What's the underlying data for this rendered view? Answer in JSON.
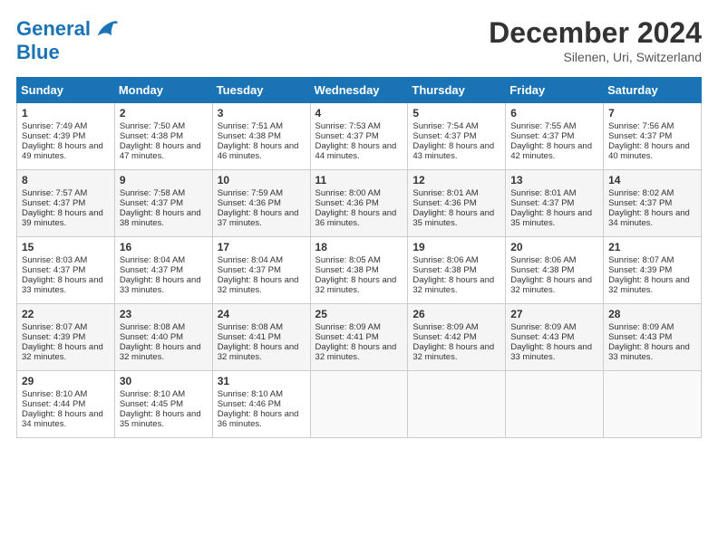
{
  "header": {
    "logo_line1": "General",
    "logo_line2": "Blue",
    "month": "December 2024",
    "location": "Silenen, Uri, Switzerland"
  },
  "days_of_week": [
    "Sunday",
    "Monday",
    "Tuesday",
    "Wednesday",
    "Thursday",
    "Friday",
    "Saturday"
  ],
  "weeks": [
    [
      {
        "day": "1",
        "sunrise": "Sunrise: 7:49 AM",
        "sunset": "Sunset: 4:39 PM",
        "daylight": "Daylight: 8 hours and 49 minutes."
      },
      {
        "day": "2",
        "sunrise": "Sunrise: 7:50 AM",
        "sunset": "Sunset: 4:38 PM",
        "daylight": "Daylight: 8 hours and 47 minutes."
      },
      {
        "day": "3",
        "sunrise": "Sunrise: 7:51 AM",
        "sunset": "Sunset: 4:38 PM",
        "daylight": "Daylight: 8 hours and 46 minutes."
      },
      {
        "day": "4",
        "sunrise": "Sunrise: 7:53 AM",
        "sunset": "Sunset: 4:37 PM",
        "daylight": "Daylight: 8 hours and 44 minutes."
      },
      {
        "day": "5",
        "sunrise": "Sunrise: 7:54 AM",
        "sunset": "Sunset: 4:37 PM",
        "daylight": "Daylight: 8 hours and 43 minutes."
      },
      {
        "day": "6",
        "sunrise": "Sunrise: 7:55 AM",
        "sunset": "Sunset: 4:37 PM",
        "daylight": "Daylight: 8 hours and 42 minutes."
      },
      {
        "day": "7",
        "sunrise": "Sunrise: 7:56 AM",
        "sunset": "Sunset: 4:37 PM",
        "daylight": "Daylight: 8 hours and 40 minutes."
      }
    ],
    [
      {
        "day": "8",
        "sunrise": "Sunrise: 7:57 AM",
        "sunset": "Sunset: 4:37 PM",
        "daylight": "Daylight: 8 hours and 39 minutes."
      },
      {
        "day": "9",
        "sunrise": "Sunrise: 7:58 AM",
        "sunset": "Sunset: 4:37 PM",
        "daylight": "Daylight: 8 hours and 38 minutes."
      },
      {
        "day": "10",
        "sunrise": "Sunrise: 7:59 AM",
        "sunset": "Sunset: 4:36 PM",
        "daylight": "Daylight: 8 hours and 37 minutes."
      },
      {
        "day": "11",
        "sunrise": "Sunrise: 8:00 AM",
        "sunset": "Sunset: 4:36 PM",
        "daylight": "Daylight: 8 hours and 36 minutes."
      },
      {
        "day": "12",
        "sunrise": "Sunrise: 8:01 AM",
        "sunset": "Sunset: 4:36 PM",
        "daylight": "Daylight: 8 hours and 35 minutes."
      },
      {
        "day": "13",
        "sunrise": "Sunrise: 8:01 AM",
        "sunset": "Sunset: 4:37 PM",
        "daylight": "Daylight: 8 hours and 35 minutes."
      },
      {
        "day": "14",
        "sunrise": "Sunrise: 8:02 AM",
        "sunset": "Sunset: 4:37 PM",
        "daylight": "Daylight: 8 hours and 34 minutes."
      }
    ],
    [
      {
        "day": "15",
        "sunrise": "Sunrise: 8:03 AM",
        "sunset": "Sunset: 4:37 PM",
        "daylight": "Daylight: 8 hours and 33 minutes."
      },
      {
        "day": "16",
        "sunrise": "Sunrise: 8:04 AM",
        "sunset": "Sunset: 4:37 PM",
        "daylight": "Daylight: 8 hours and 33 minutes."
      },
      {
        "day": "17",
        "sunrise": "Sunrise: 8:04 AM",
        "sunset": "Sunset: 4:37 PM",
        "daylight": "Daylight: 8 hours and 32 minutes."
      },
      {
        "day": "18",
        "sunrise": "Sunrise: 8:05 AM",
        "sunset": "Sunset: 4:38 PM",
        "daylight": "Daylight: 8 hours and 32 minutes."
      },
      {
        "day": "19",
        "sunrise": "Sunrise: 8:06 AM",
        "sunset": "Sunset: 4:38 PM",
        "daylight": "Daylight: 8 hours and 32 minutes."
      },
      {
        "day": "20",
        "sunrise": "Sunrise: 8:06 AM",
        "sunset": "Sunset: 4:38 PM",
        "daylight": "Daylight: 8 hours and 32 minutes."
      },
      {
        "day": "21",
        "sunrise": "Sunrise: 8:07 AM",
        "sunset": "Sunset: 4:39 PM",
        "daylight": "Daylight: 8 hours and 32 minutes."
      }
    ],
    [
      {
        "day": "22",
        "sunrise": "Sunrise: 8:07 AM",
        "sunset": "Sunset: 4:39 PM",
        "daylight": "Daylight: 8 hours and 32 minutes."
      },
      {
        "day": "23",
        "sunrise": "Sunrise: 8:08 AM",
        "sunset": "Sunset: 4:40 PM",
        "daylight": "Daylight: 8 hours and 32 minutes."
      },
      {
        "day": "24",
        "sunrise": "Sunrise: 8:08 AM",
        "sunset": "Sunset: 4:41 PM",
        "daylight": "Daylight: 8 hours and 32 minutes."
      },
      {
        "day": "25",
        "sunrise": "Sunrise: 8:09 AM",
        "sunset": "Sunset: 4:41 PM",
        "daylight": "Daylight: 8 hours and 32 minutes."
      },
      {
        "day": "26",
        "sunrise": "Sunrise: 8:09 AM",
        "sunset": "Sunset: 4:42 PM",
        "daylight": "Daylight: 8 hours and 32 minutes."
      },
      {
        "day": "27",
        "sunrise": "Sunrise: 8:09 AM",
        "sunset": "Sunset: 4:43 PM",
        "daylight": "Daylight: 8 hours and 33 minutes."
      },
      {
        "day": "28",
        "sunrise": "Sunrise: 8:09 AM",
        "sunset": "Sunset: 4:43 PM",
        "daylight": "Daylight: 8 hours and 33 minutes."
      }
    ],
    [
      {
        "day": "29",
        "sunrise": "Sunrise: 8:10 AM",
        "sunset": "Sunset: 4:44 PM",
        "daylight": "Daylight: 8 hours and 34 minutes."
      },
      {
        "day": "30",
        "sunrise": "Sunrise: 8:10 AM",
        "sunset": "Sunset: 4:45 PM",
        "daylight": "Daylight: 8 hours and 35 minutes."
      },
      {
        "day": "31",
        "sunrise": "Sunrise: 8:10 AM",
        "sunset": "Sunset: 4:46 PM",
        "daylight": "Daylight: 8 hours and 36 minutes."
      },
      null,
      null,
      null,
      null
    ]
  ]
}
